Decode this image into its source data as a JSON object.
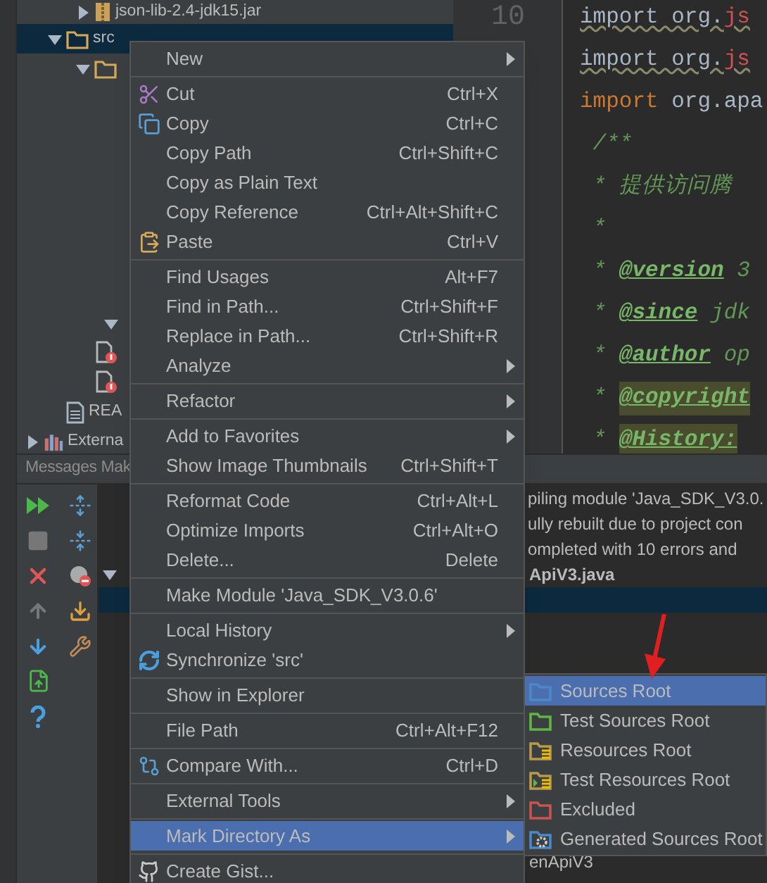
{
  "tree": [
    {
      "label": "json-lib-2.4-jdk15.jar",
      "kind": "jar",
      "expanded": false,
      "selected": false
    },
    {
      "label": "src",
      "kind": "folder",
      "expanded": true,
      "selected": true,
      "children": [
        {
          "kind": "folder",
          "expanded": true,
          "selected": false,
          "children": [
            {
              "expanded": true,
              "selected": false
            }
          ]
        },
        {
          "kind": "error-file",
          "selected": false
        },
        {
          "kind": "error-file",
          "selected": false
        }
      ]
    },
    {
      "label": "REA",
      "kind": "file",
      "selected": false
    },
    {
      "label": "Externa",
      "kind": "library",
      "expanded": false,
      "selected": false
    }
  ],
  "editor": {
    "line_number": "10",
    "lines": [
      {
        "parts": [
          {
            "kind": "plain",
            "text": "import org."
          },
          {
            "kind": "error",
            "text": "js"
          }
        ]
      },
      {
        "parts": [
          {
            "kind": "plain",
            "text": "import org."
          },
          {
            "kind": "error",
            "text": "js"
          }
        ]
      },
      {
        "parts": [
          {
            "kind": "keyword",
            "text": "import"
          },
          {
            "kind": "code",
            "text": " org.apa"
          }
        ]
      },
      {
        "parts": [
          {
            "kind": "comment",
            "text": " /**"
          }
        ]
      },
      {
        "parts": [
          {
            "kind": "comment",
            "text": " * 提供访问腾"
          }
        ]
      },
      {
        "parts": [
          {
            "kind": "comment",
            "text": " *"
          }
        ]
      },
      {
        "parts": [
          {
            "kind": "comment",
            "text": " * "
          },
          {
            "kind": "tag",
            "text": "@version"
          },
          {
            "kind": "comment",
            "text": " 3"
          }
        ]
      },
      {
        "parts": [
          {
            "kind": "comment",
            "text": " * "
          },
          {
            "kind": "tag",
            "text": "@since"
          },
          {
            "kind": "comment",
            "text": " jdk"
          }
        ]
      },
      {
        "parts": [
          {
            "kind": "comment",
            "text": " * "
          },
          {
            "kind": "tag",
            "text": "@author"
          },
          {
            "kind": "comment",
            "text": " op"
          }
        ]
      },
      {
        "highlighted": true,
        "parts": [
          {
            "kind": "comment",
            "text": " * "
          },
          {
            "kind": "tag",
            "text": "@copyright"
          }
        ]
      },
      {
        "highlighted": true,
        "parts": [
          {
            "kind": "comment",
            "text": " * "
          },
          {
            "kind": "tag",
            "text": "@History:"
          }
        ]
      }
    ]
  },
  "messages": {
    "title": "Messages Mak",
    "lines": [
      "piling module 'Java_SDK_V3.0.",
      "ully rebuilt due to project con",
      "ompleted with 10 errors and"
    ],
    "nodes": [
      {
        "label": "ApiV3.java",
        "expanded": true,
        "selected": false
      },
      {
        "selected": true
      },
      {
        "label": "enApiV3",
        "selected": false
      }
    ]
  },
  "context_menu": [
    {
      "kind": "item",
      "label": "New",
      "submenu": true,
      "selected": false
    },
    {
      "kind": "separator"
    },
    {
      "kind": "item",
      "label": "Cut",
      "shortcut": "Ctrl+X",
      "selected": false
    },
    {
      "kind": "item",
      "label": "Copy",
      "shortcut": "Ctrl+C",
      "selected": false
    },
    {
      "kind": "item",
      "label": "Copy Path",
      "shortcut": "Ctrl+Shift+C",
      "selected": false
    },
    {
      "kind": "item",
      "label": "Copy as Plain Text",
      "selected": false
    },
    {
      "kind": "item",
      "label": "Copy Reference",
      "shortcut": "Ctrl+Alt+Shift+C",
      "selected": false
    },
    {
      "kind": "item",
      "label": "Paste",
      "shortcut": "Ctrl+V",
      "selected": false
    },
    {
      "kind": "separator"
    },
    {
      "kind": "item",
      "label": "Find Usages",
      "shortcut": "Alt+F7",
      "selected": false
    },
    {
      "kind": "item",
      "label": "Find in Path...",
      "shortcut": "Ctrl+Shift+F",
      "selected": false
    },
    {
      "kind": "item",
      "label": "Replace in Path...",
      "shortcut": "Ctrl+Shift+R",
      "selected": false
    },
    {
      "kind": "item",
      "label": "Analyze",
      "submenu": true,
      "selected": false
    },
    {
      "kind": "separator"
    },
    {
      "kind": "item",
      "label": "Refactor",
      "submenu": true,
      "selected": false
    },
    {
      "kind": "separator"
    },
    {
      "kind": "item",
      "label": "Add to Favorites",
      "submenu": true,
      "selected": false
    },
    {
      "kind": "item",
      "label": "Show Image Thumbnails",
      "shortcut": "Ctrl+Shift+T",
      "selected": false
    },
    {
      "kind": "separator"
    },
    {
      "kind": "item",
      "label": "Reformat Code",
      "shortcut": "Ctrl+Alt+L",
      "selected": false
    },
    {
      "kind": "item",
      "label": "Optimize Imports",
      "shortcut": "Ctrl+Alt+O",
      "selected": false
    },
    {
      "kind": "item",
      "label": "Delete...",
      "shortcut": "Delete",
      "selected": false
    },
    {
      "kind": "separator"
    },
    {
      "kind": "item",
      "label": "Make Module 'Java_SDK_V3.0.6'",
      "selected": false
    },
    {
      "kind": "separator"
    },
    {
      "kind": "item",
      "label": "Local History",
      "submenu": true,
      "selected": false
    },
    {
      "kind": "item",
      "label": "Synchronize 'src'",
      "selected": false
    },
    {
      "kind": "separator"
    },
    {
      "kind": "item",
      "label": "Show in Explorer",
      "selected": false
    },
    {
      "kind": "separator"
    },
    {
      "kind": "item",
      "label": "File Path",
      "shortcut": "Ctrl+Alt+F12",
      "selected": false
    },
    {
      "kind": "separator"
    },
    {
      "kind": "item",
      "label": "Compare With...",
      "shortcut": "Ctrl+D",
      "selected": false
    },
    {
      "kind": "separator"
    },
    {
      "kind": "item",
      "label": "External Tools",
      "submenu": true,
      "selected": false
    },
    {
      "kind": "separator"
    },
    {
      "kind": "item",
      "label": "Mark Directory As",
      "submenu": true,
      "selected": true
    },
    {
      "kind": "separator"
    },
    {
      "kind": "item",
      "label": "Create Gist...",
      "selected": false
    }
  ],
  "submenu": [
    {
      "label": "Sources Root",
      "kind": "folder",
      "color": "#4a88c7",
      "selected": true
    },
    {
      "label": "Test Sources Root",
      "kind": "folder",
      "color": "#62b543",
      "selected": false
    },
    {
      "label": "Resources Root",
      "kind": "resources",
      "color": "#b99a4a",
      "selected": false
    },
    {
      "label": "Test Resources Root",
      "kind": "test",
      "color": "#b99a4a",
      "selected": false
    },
    {
      "label": "Excluded",
      "kind": "folder",
      "color": "#c75450",
      "selected": false
    },
    {
      "label": "Generated Sources Root",
      "kind": "generated",
      "color": "#4a88c7",
      "selected": false
    }
  ]
}
